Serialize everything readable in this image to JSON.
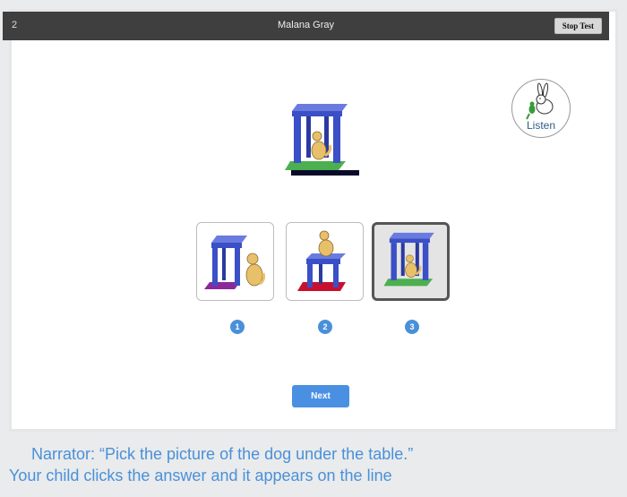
{
  "topbar": {
    "question_number": "2",
    "student_name": "Malana Gray",
    "stop_label": "Stop Test"
  },
  "listen": {
    "label": "Listen"
  },
  "choices": [
    {
      "number": "1",
      "scene": "dog-beside-table"
    },
    {
      "number": "2",
      "scene": "dog-on-table"
    },
    {
      "number": "3",
      "scene": "dog-under-table",
      "selected": true
    }
  ],
  "next_label": "Next",
  "caption": {
    "line1": "Narrator: “Pick the picture of the dog under the table.”",
    "line2": "Your child clicks the answer and it appears on the line"
  },
  "colors": {
    "topbar": "#3f3f3f",
    "accent": "#4a90e2",
    "table": "#3b4fc7",
    "caption": "#4a90d9"
  }
}
